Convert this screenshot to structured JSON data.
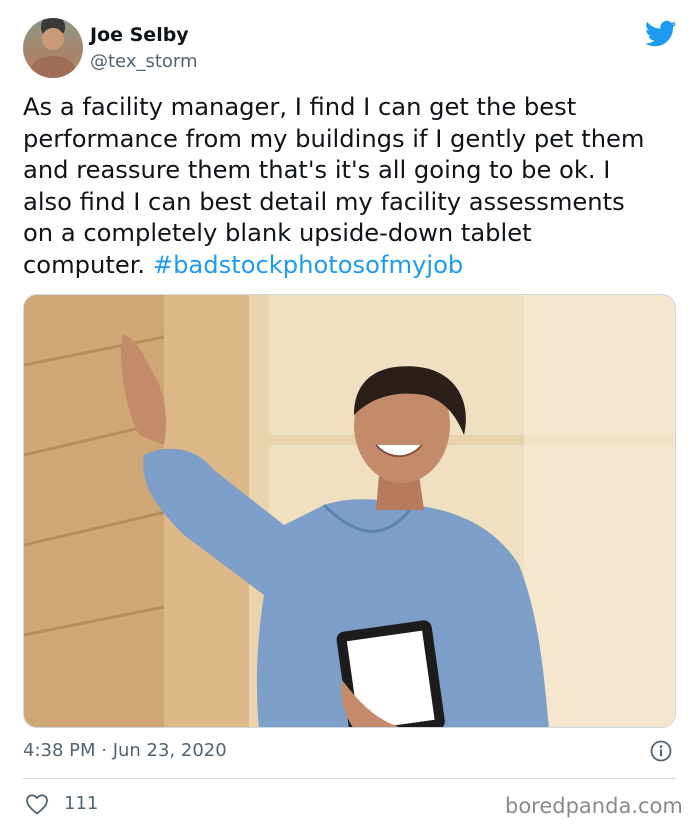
{
  "tweet": {
    "author_name": "Joe Selby",
    "author_handle": "@tex_storm",
    "text_lines": [
      "As a facility manager, I find I can get the best",
      "performance from my buildings if I gently pet them",
      "and reassure them that's it's all going to be ok. I",
      "also find I can best detail my facility assessments",
      "on a completely blank upside-down tablet",
      "computer. "
    ],
    "hashtag": "#badstockphotosofmyjob",
    "timestamp": "4:38 PM · Jun 23, 2020",
    "likes": "111"
  },
  "icons": {
    "brand": "twitter-bird-icon",
    "info": "info-icon",
    "like": "heart-icon"
  },
  "colors": {
    "accent": "#1d9bf0",
    "text": "#0f1419",
    "secondary": "#536471"
  },
  "watermark": "boredpanda.com"
}
